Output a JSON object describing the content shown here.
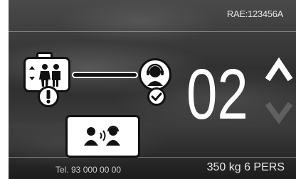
{
  "header": {
    "rae_code": "RAE:123456A"
  },
  "status": {
    "floor_number": "02",
    "direction_up_active": true,
    "direction_down_active": false
  },
  "icons": {
    "cabin": "elevator-cabin-icon",
    "passengers": "passengers-icon",
    "alarm": "exclamation-icon",
    "link": "connection-line-icon",
    "operator": "operator-headset-icon",
    "confirmed": "check-icon",
    "call": "voice-call-icon"
  },
  "footer": {
    "telephone": "Tel. 93 000 00 00",
    "capacity": "350 kg 6 PERS"
  },
  "colors": {
    "background": "#2c2c2c",
    "foreground": "#ffffff",
    "icon_stroke": "#111111"
  }
}
